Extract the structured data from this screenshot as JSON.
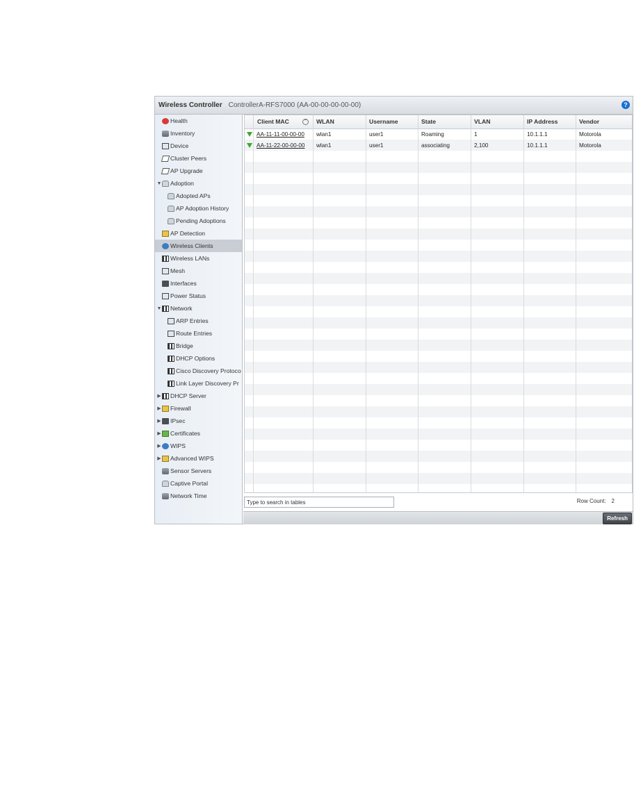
{
  "window": {
    "title": "Wireless Controller",
    "device": "ControllerA-RFS7000 (AA-00-00-00-00-00)",
    "help_icon": "?"
  },
  "sidebar": {
    "items": [
      {
        "label": "Health",
        "icon": "health-icon",
        "arrow": ""
      },
      {
        "label": "Inventory",
        "icon": "inventory-icon",
        "arrow": ""
      },
      {
        "label": "Device",
        "icon": "device-icon",
        "arrow": ""
      },
      {
        "label": "Cluster Peers",
        "icon": "cluster-peers-icon",
        "arrow": ""
      },
      {
        "label": "AP Upgrade",
        "icon": "ap-upgrade-icon",
        "arrow": ""
      },
      {
        "label": "Adoption",
        "icon": "adoption-icon",
        "arrow": "▼"
      },
      {
        "label": "Adopted APs",
        "icon": "adopted-aps-icon",
        "arrow": ""
      },
      {
        "label": "AP Adoption History",
        "icon": "ap-adoption-history-icon",
        "arrow": ""
      },
      {
        "label": "Pending Adoptions",
        "icon": "pending-adoptions-icon",
        "arrow": ""
      },
      {
        "label": "AP Detection",
        "icon": "ap-detection-icon",
        "arrow": ""
      },
      {
        "label": "Wireless Clients",
        "icon": "wireless-clients-icon",
        "arrow": ""
      },
      {
        "label": "Wireless LANs",
        "icon": "wireless-lans-icon",
        "arrow": ""
      },
      {
        "label": "Mesh",
        "icon": "mesh-icon",
        "arrow": ""
      },
      {
        "label": "Interfaces",
        "icon": "interfaces-icon",
        "arrow": ""
      },
      {
        "label": "Power Status",
        "icon": "power-status-icon",
        "arrow": ""
      },
      {
        "label": "Network",
        "icon": "network-icon",
        "arrow": "▼"
      },
      {
        "label": "ARP Entries",
        "icon": "arp-entries-icon",
        "arrow": ""
      },
      {
        "label": "Route Entries",
        "icon": "route-entries-icon",
        "arrow": ""
      },
      {
        "label": "Bridge",
        "icon": "bridge-icon",
        "arrow": ""
      },
      {
        "label": "DHCP Options",
        "icon": "dhcp-options-icon",
        "arrow": ""
      },
      {
        "label": "Cisco Discovery Protoco",
        "icon": "cisco-discovery-icon",
        "arrow": ""
      },
      {
        "label": "Link Layer Discovery Pr",
        "icon": "link-layer-discovery-icon",
        "arrow": ""
      },
      {
        "label": "DHCP Server",
        "icon": "dhcp-server-icon",
        "arrow": "▶"
      },
      {
        "label": "Firewall",
        "icon": "firewall-icon",
        "arrow": "▶"
      },
      {
        "label": "IPsec",
        "icon": "ipsec-icon",
        "arrow": "▶"
      },
      {
        "label": "Certificates",
        "icon": "certificates-icon",
        "arrow": "▶"
      },
      {
        "label": "WIPS",
        "icon": "wips-icon",
        "arrow": "▶"
      },
      {
        "label": "Advanced WIPS",
        "icon": "advanced-wips-icon",
        "arrow": "▶"
      },
      {
        "label": "Sensor Servers",
        "icon": "sensor-servers-icon",
        "arrow": ""
      },
      {
        "label": "Captive Portal",
        "icon": "captive-portal-icon",
        "arrow": ""
      },
      {
        "label": "Network Time",
        "icon": "network-time-icon",
        "arrow": ""
      }
    ],
    "selected": "Wireless Clients"
  },
  "table": {
    "columns": [
      "Client MAC",
      "WLAN",
      "Username",
      "State",
      "VLAN",
      "IP Address",
      "Vendor"
    ],
    "rows": [
      {
        "mac": "AA-11-11-00-00-00",
        "wlan": "wlan1",
        "username": "user1",
        "state": "Roaming",
        "vlan": "1",
        "ip": "10.1.1.1",
        "vendor": "Motorola"
      },
      {
        "mac": "AA-11-22-00-00-00",
        "wlan": "wlan1",
        "username": "user1",
        "state": "associating",
        "vlan": "2,100",
        "ip": "10.1.1.1",
        "vendor": "Motorola"
      }
    ]
  },
  "search": {
    "placeholder": "Type to search in tables"
  },
  "row_count": {
    "label": "Row Count:",
    "value": "2"
  },
  "footer": {
    "refresh_label": "Refresh"
  },
  "colors": {
    "selected_row": "#c9ced4",
    "status_green": "#3ea534",
    "help_blue": "#1a6fd1"
  }
}
